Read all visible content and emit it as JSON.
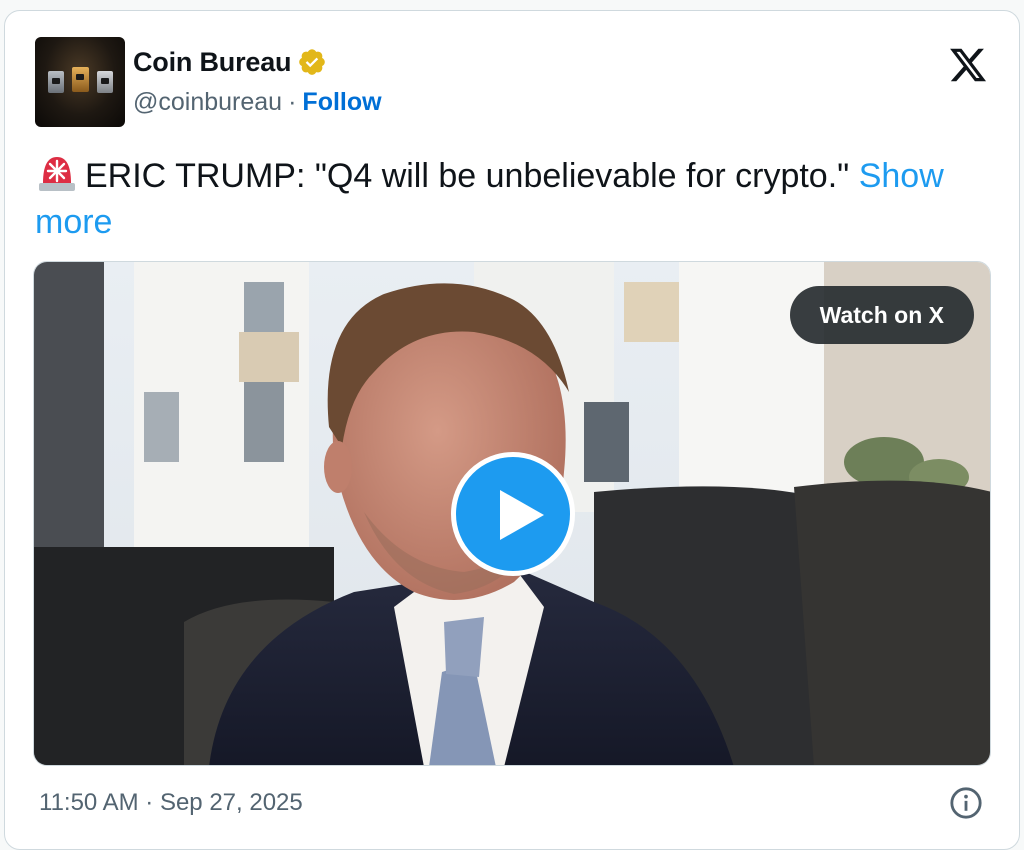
{
  "author": {
    "name": "Coin Bureau",
    "handle": "@coinbureau",
    "separator": "·",
    "follow_label": "Follow",
    "verified_color": "#e2b719",
    "avatar_icon": "coin-bureau-logo"
  },
  "tweet": {
    "emoji": "rotating-light",
    "text": "ERIC TRUMP: \"Q4 will be unbelievable for crypto.\"",
    "show_more_label": "Show more"
  },
  "media": {
    "type": "video",
    "watch_label": "Watch on X",
    "play_icon": "play-icon"
  },
  "footer": {
    "timestamp": "11:50 AM · Sep 27, 2025",
    "info_icon": "info-icon"
  },
  "colors": {
    "link": "#1d9bf0",
    "follow": "#006fd6",
    "text": "#0f1419",
    "muted": "#536471",
    "border": "#cfd9de"
  }
}
